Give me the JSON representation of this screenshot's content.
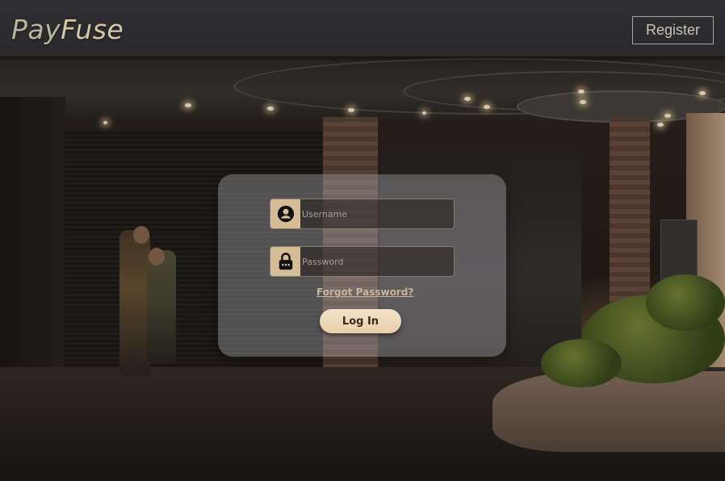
{
  "header": {
    "logo_part1": "Pay",
    "logo_part2": "Fuse",
    "register_label": "Register"
  },
  "login": {
    "username_placeholder": "Username",
    "password_placeholder": "Password",
    "forgot_label": "Forgot Password?",
    "login_label": "Log In"
  },
  "icons": {
    "username": "user-circle-icon",
    "password": "lock-icon"
  },
  "colors": {
    "accent": "#d6bd98",
    "button": "#f0dcbc",
    "header_bg": "#2d2d2f"
  }
}
